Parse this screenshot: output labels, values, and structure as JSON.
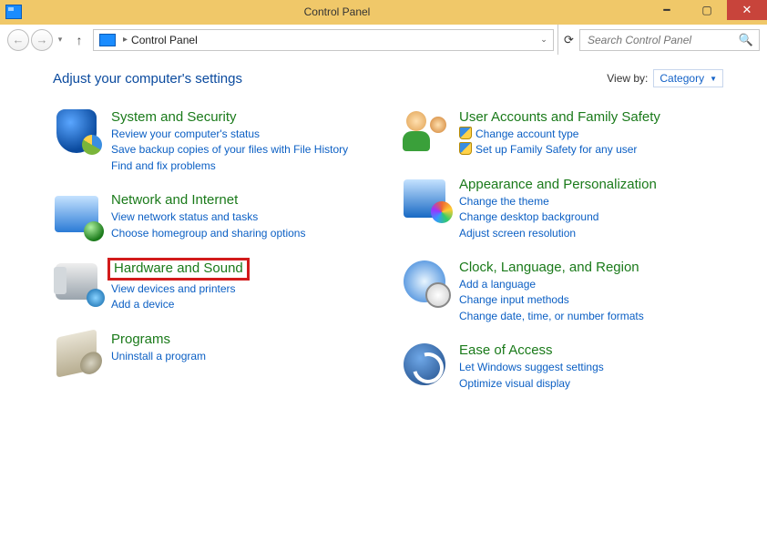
{
  "window": {
    "title": "Control Panel"
  },
  "address": {
    "path": "Control Panel"
  },
  "search": {
    "placeholder": "Search Control Panel"
  },
  "heading": "Adjust your computer's settings",
  "viewby": {
    "label": "View by:",
    "value": "Category"
  },
  "cats": {
    "sys": {
      "title": "System and Security",
      "links": [
        "Review your computer's status",
        "Save backup copies of your files with File History",
        "Find and fix problems"
      ]
    },
    "net": {
      "title": "Network and Internet",
      "links": [
        "View network status and tasks",
        "Choose homegroup and sharing options"
      ]
    },
    "hw": {
      "title": "Hardware and Sound",
      "links": [
        "View devices and printers",
        "Add a device"
      ]
    },
    "prog": {
      "title": "Programs",
      "links": [
        "Uninstall a program"
      ]
    },
    "user": {
      "title": "User Accounts and Family Safety",
      "links": [
        "Change account type",
        "Set up Family Safety for any user"
      ]
    },
    "appear": {
      "title": "Appearance and Personalization",
      "links": [
        "Change the theme",
        "Change desktop background",
        "Adjust screen resolution"
      ]
    },
    "clock": {
      "title": "Clock, Language, and Region",
      "links": [
        "Add a language",
        "Change input methods",
        "Change date, time, or number formats"
      ]
    },
    "ease": {
      "title": "Ease of Access",
      "links": [
        "Let Windows suggest settings",
        "Optimize visual display"
      ]
    }
  }
}
